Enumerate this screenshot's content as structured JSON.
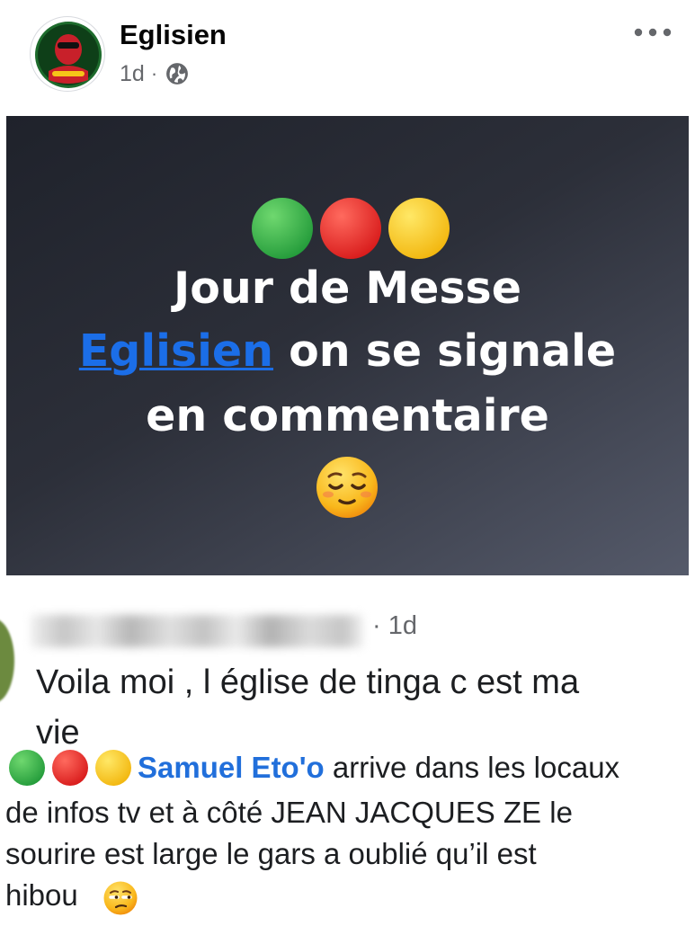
{
  "post": {
    "author": "Eglisien",
    "time": "1d",
    "separator": "·",
    "image_text": {
      "line1": "Jour de Messe",
      "line2_link": "Eglisien",
      "line2_rest": " on se signale",
      "line3": "en commentaire"
    }
  },
  "comments": [
    {
      "time": "1d",
      "separator": "·",
      "text_line1": "Voila moi , l église de tinga c est ma",
      "text_line2": "vie"
    },
    {
      "mention": "Samuel Eto'o",
      "line1_rest": " arrive dans les locaux",
      "line2": "de infos tv et à côté JEAN JACQUES ZE le",
      "line3": "sourire est large le gars a oublié qu’il est",
      "line4": "hibou "
    }
  ],
  "colors": {
    "link_blue": "#1b6ee8",
    "mention_blue": "#216fdb",
    "cameroon_green": "#2fa84a",
    "cameroon_red": "#e52420",
    "cameroon_yellow": "#f6c518",
    "secondary_text": "#65676b"
  },
  "icons": [
    "globe-icon",
    "more-options-icon",
    "relieved-face-emoji",
    "unamused-face-emoji"
  ]
}
